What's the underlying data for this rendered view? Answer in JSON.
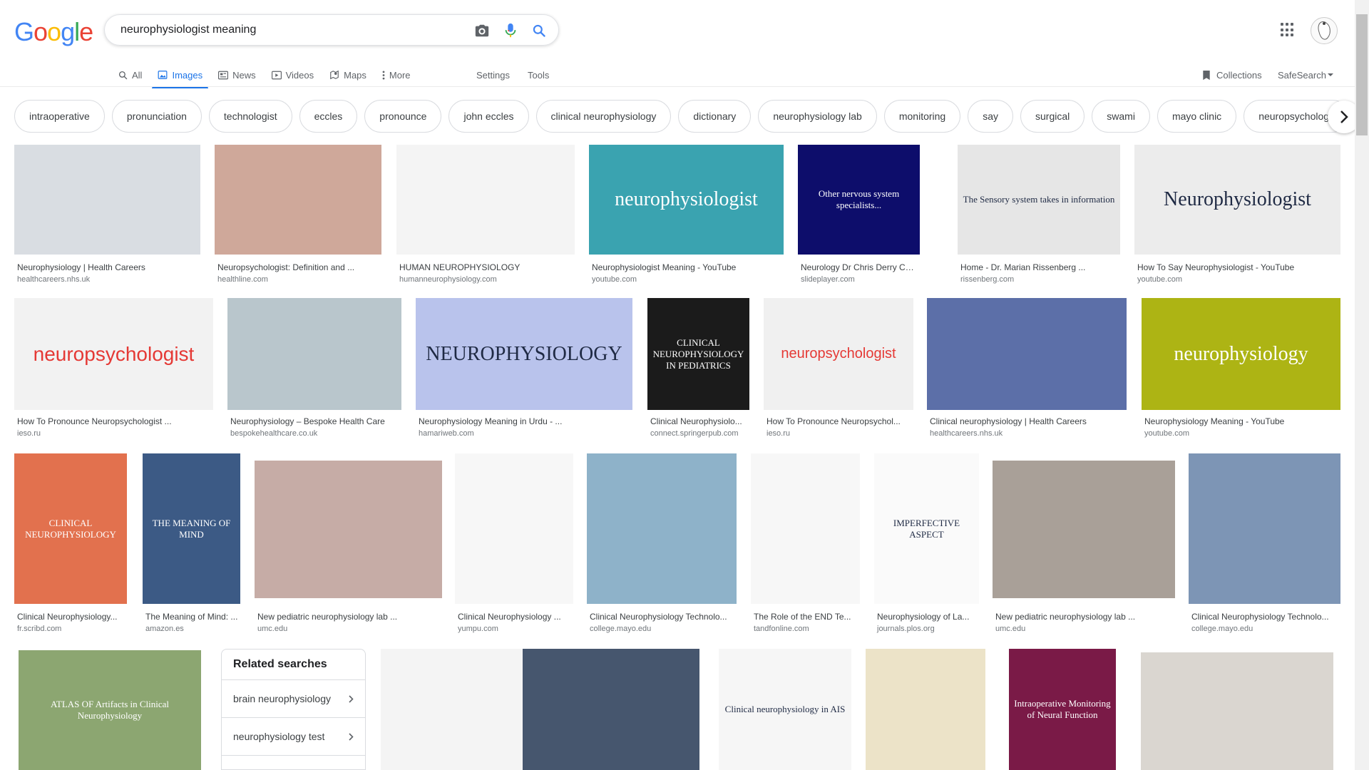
{
  "search": {
    "query": "neurophysiologist meaning"
  },
  "logo": {
    "letters": [
      "G",
      "o",
      "o",
      "g",
      "l",
      "e"
    ],
    "colors": [
      "#4285f4",
      "#ea4335",
      "#fbbc05",
      "#4285f4",
      "#34a853",
      "#ea4335"
    ]
  },
  "tabs": [
    {
      "label": "All",
      "icon": "search-icon"
    },
    {
      "label": "Images",
      "icon": "image-icon",
      "active": true
    },
    {
      "label": "News",
      "icon": "news-icon"
    },
    {
      "label": "Videos",
      "icon": "video-icon"
    },
    {
      "label": "Maps",
      "icon": "map-icon"
    },
    {
      "label": "More",
      "icon": "more-vert-icon"
    }
  ],
  "toolbar": {
    "settings": "Settings",
    "tools": "Tools",
    "collections": "Collections",
    "safesearch": "SafeSearch"
  },
  "chips": [
    "intraoperative",
    "pronunciation",
    "technologist",
    "eccles",
    "pronounce",
    "john eccles",
    "clinical neurophysiology",
    "dictionary",
    "neurophysiology lab",
    "monitoring",
    "say",
    "surgical",
    "swami",
    "mayo clinic",
    "neuropsychology"
  ],
  "results": [
    {
      "title": "Neurophysiology | Health Careers",
      "source": "healthcareers.nhs.uk",
      "thumb_text": "",
      "bg": "#d9dde2"
    },
    {
      "title": "Neuropsychologist: Definition and ...",
      "source": "healthline.com",
      "thumb_text": "",
      "bg": "#cfa89a"
    },
    {
      "title": "HUMAN NEUROPHYSIOLOGY",
      "source": "humanneurophysiology.com",
      "thumb_text": "",
      "bg": "#f4f4f4"
    },
    {
      "title": "Neurophysiologist Meaning - YouTube",
      "source": "youtube.com",
      "thumb_text": "neurophysiologist",
      "bg": "#3aa3b0"
    },
    {
      "title": "Neurology Dr Chris Derry Consul...",
      "source": "slideplayer.com",
      "thumb_text": "Other nervous system specialists...",
      "bg": "#0d0d6b"
    },
    {
      "title": "Home - Dr. Marian Rissenberg ...",
      "source": "rissenberg.com",
      "thumb_text": "The Sensory system takes in information",
      "bg": "#e6e6e6"
    },
    {
      "title": "How To Say Neurophysiologist - YouTube",
      "source": "youtube.com",
      "thumb_text": "Neurophysiologist",
      "bg": "#ececec"
    },
    {
      "title": "How To Pronounce Neuropsychologist ...",
      "source": "ieso.ru",
      "thumb_text": "neuropsychologist",
      "bg": "#f2f2f2"
    },
    {
      "title": "Neurophysiology – Bespoke Health Care",
      "source": "bespokehealthcare.co.uk",
      "thumb_text": "",
      "bg": "#b9c6cc"
    },
    {
      "title": "Neurophysiology Meaning in Urdu - ...",
      "source": "hamariweb.com",
      "thumb_text": "NEUROPHYSIOLOGY",
      "bg": "#b9c3ec"
    },
    {
      "title": "Clinical Neurophysiolo...",
      "source": "connect.springerpub.com",
      "thumb_text": "CLINICAL NEUROPHYSIOLOGY IN PEDIATRICS",
      "bg": "#1b1b1b"
    },
    {
      "title": "How To Pronounce Neuropsychol...",
      "source": "ieso.ru",
      "thumb_text": "neuropsychologist",
      "bg": "#f0f0f0"
    },
    {
      "title": "Clinical neurophysiology | Health Careers",
      "source": "healthcareers.nhs.uk",
      "thumb_text": "",
      "bg": "#5c6fa8"
    },
    {
      "title": "Neurophysiology Meaning - YouTube",
      "source": "youtube.com",
      "thumb_text": "neurophysiology",
      "bg": "#adb414"
    },
    {
      "title": "Clinical Neurophysiology...",
      "source": "fr.scribd.com",
      "thumb_text": "CLINICAL NEUROPHYSIOLOGY",
      "bg": "#e2714e"
    },
    {
      "title": "The Meaning of Mind: ...",
      "source": "amazon.es",
      "thumb_text": "THE MEANING OF MIND",
      "bg": "#3c5a85"
    },
    {
      "title": "New pediatric neurophysiology lab ...",
      "source": "umc.edu",
      "thumb_text": "",
      "bg": "#c6aca6"
    },
    {
      "title": "Clinical Neurophysiology ...",
      "source": "yumpu.com",
      "thumb_text": "",
      "bg": "#f7f7f7"
    },
    {
      "title": "Clinical Neurophysiology Technolo...",
      "source": "college.mayo.edu",
      "thumb_text": "",
      "bg": "#8eb2c9"
    },
    {
      "title": "The Role of the END Te...",
      "source": "tandfonline.com",
      "thumb_text": "",
      "bg": "#f7f7f7"
    },
    {
      "title": "Neurophysiology of La...",
      "source": "journals.plos.org",
      "thumb_text": "IMPERFECTIVE ASPECT",
      "bg": "#fafafa"
    },
    {
      "title": "New pediatric neurophysiology lab ...",
      "source": "umc.edu",
      "thumb_text": "",
      "bg": "#a9a098"
    },
    {
      "title": "Clinical Neurophysiology Technolo...",
      "source": "college.mayo.edu",
      "thumb_text": "",
      "bg": "#7d95b5"
    },
    {
      "title": "",
      "source": "",
      "thumb_text": "ATLAS OF Artifacts in Clinical Neurophysiology",
      "bg": "#8ca671"
    },
    {
      "title": "",
      "source": "",
      "thumb_text": "",
      "bg": "#f4f4f4"
    },
    {
      "title": "",
      "source": "",
      "thumb_text": "",
      "bg": "#46566e"
    },
    {
      "title": "",
      "source": "",
      "thumb_text": "Clinical neurophysiology in AIS",
      "bg": "#f6f6f6"
    },
    {
      "title": "",
      "source": "",
      "thumb_text": "",
      "bg": "#ece3c8"
    },
    {
      "title": "",
      "source": "",
      "thumb_text": "Intraoperative Monitoring of Neural Function",
      "bg": "#7a1a47"
    },
    {
      "title": "",
      "source": "",
      "thumb_text": "",
      "bg": "#dad6d0"
    }
  ],
  "related": {
    "heading": "Related searches",
    "items": [
      {
        "label": "brain neurophysiology"
      },
      {
        "label": "neurophysiology test"
      }
    ]
  }
}
